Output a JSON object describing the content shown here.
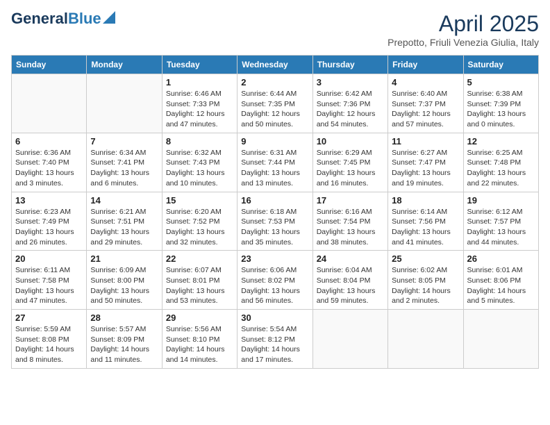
{
  "header": {
    "logo_line1": "General",
    "logo_line2": "Blue",
    "month_year": "April 2025",
    "location": "Prepotto, Friuli Venezia Giulia, Italy"
  },
  "days_of_week": [
    "Sunday",
    "Monday",
    "Tuesday",
    "Wednesday",
    "Thursday",
    "Friday",
    "Saturday"
  ],
  "weeks": [
    [
      {
        "day": "",
        "info": ""
      },
      {
        "day": "",
        "info": ""
      },
      {
        "day": "1",
        "info": "Sunrise: 6:46 AM\nSunset: 7:33 PM\nDaylight: 12 hours and 47 minutes."
      },
      {
        "day": "2",
        "info": "Sunrise: 6:44 AM\nSunset: 7:35 PM\nDaylight: 12 hours and 50 minutes."
      },
      {
        "day": "3",
        "info": "Sunrise: 6:42 AM\nSunset: 7:36 PM\nDaylight: 12 hours and 54 minutes."
      },
      {
        "day": "4",
        "info": "Sunrise: 6:40 AM\nSunset: 7:37 PM\nDaylight: 12 hours and 57 minutes."
      },
      {
        "day": "5",
        "info": "Sunrise: 6:38 AM\nSunset: 7:39 PM\nDaylight: 13 hours and 0 minutes."
      }
    ],
    [
      {
        "day": "6",
        "info": "Sunrise: 6:36 AM\nSunset: 7:40 PM\nDaylight: 13 hours and 3 minutes."
      },
      {
        "day": "7",
        "info": "Sunrise: 6:34 AM\nSunset: 7:41 PM\nDaylight: 13 hours and 6 minutes."
      },
      {
        "day": "8",
        "info": "Sunrise: 6:32 AM\nSunset: 7:43 PM\nDaylight: 13 hours and 10 minutes."
      },
      {
        "day": "9",
        "info": "Sunrise: 6:31 AM\nSunset: 7:44 PM\nDaylight: 13 hours and 13 minutes."
      },
      {
        "day": "10",
        "info": "Sunrise: 6:29 AM\nSunset: 7:45 PM\nDaylight: 13 hours and 16 minutes."
      },
      {
        "day": "11",
        "info": "Sunrise: 6:27 AM\nSunset: 7:47 PM\nDaylight: 13 hours and 19 minutes."
      },
      {
        "day": "12",
        "info": "Sunrise: 6:25 AM\nSunset: 7:48 PM\nDaylight: 13 hours and 22 minutes."
      }
    ],
    [
      {
        "day": "13",
        "info": "Sunrise: 6:23 AM\nSunset: 7:49 PM\nDaylight: 13 hours and 26 minutes."
      },
      {
        "day": "14",
        "info": "Sunrise: 6:21 AM\nSunset: 7:51 PM\nDaylight: 13 hours and 29 minutes."
      },
      {
        "day": "15",
        "info": "Sunrise: 6:20 AM\nSunset: 7:52 PM\nDaylight: 13 hours and 32 minutes."
      },
      {
        "day": "16",
        "info": "Sunrise: 6:18 AM\nSunset: 7:53 PM\nDaylight: 13 hours and 35 minutes."
      },
      {
        "day": "17",
        "info": "Sunrise: 6:16 AM\nSunset: 7:54 PM\nDaylight: 13 hours and 38 minutes."
      },
      {
        "day": "18",
        "info": "Sunrise: 6:14 AM\nSunset: 7:56 PM\nDaylight: 13 hours and 41 minutes."
      },
      {
        "day": "19",
        "info": "Sunrise: 6:12 AM\nSunset: 7:57 PM\nDaylight: 13 hours and 44 minutes."
      }
    ],
    [
      {
        "day": "20",
        "info": "Sunrise: 6:11 AM\nSunset: 7:58 PM\nDaylight: 13 hours and 47 minutes."
      },
      {
        "day": "21",
        "info": "Sunrise: 6:09 AM\nSunset: 8:00 PM\nDaylight: 13 hours and 50 minutes."
      },
      {
        "day": "22",
        "info": "Sunrise: 6:07 AM\nSunset: 8:01 PM\nDaylight: 13 hours and 53 minutes."
      },
      {
        "day": "23",
        "info": "Sunrise: 6:06 AM\nSunset: 8:02 PM\nDaylight: 13 hours and 56 minutes."
      },
      {
        "day": "24",
        "info": "Sunrise: 6:04 AM\nSunset: 8:04 PM\nDaylight: 13 hours and 59 minutes."
      },
      {
        "day": "25",
        "info": "Sunrise: 6:02 AM\nSunset: 8:05 PM\nDaylight: 14 hours and 2 minutes."
      },
      {
        "day": "26",
        "info": "Sunrise: 6:01 AM\nSunset: 8:06 PM\nDaylight: 14 hours and 5 minutes."
      }
    ],
    [
      {
        "day": "27",
        "info": "Sunrise: 5:59 AM\nSunset: 8:08 PM\nDaylight: 14 hours and 8 minutes."
      },
      {
        "day": "28",
        "info": "Sunrise: 5:57 AM\nSunset: 8:09 PM\nDaylight: 14 hours and 11 minutes."
      },
      {
        "day": "29",
        "info": "Sunrise: 5:56 AM\nSunset: 8:10 PM\nDaylight: 14 hours and 14 minutes."
      },
      {
        "day": "30",
        "info": "Sunrise: 5:54 AM\nSunset: 8:12 PM\nDaylight: 14 hours and 17 minutes."
      },
      {
        "day": "",
        "info": ""
      },
      {
        "day": "",
        "info": ""
      },
      {
        "day": "",
        "info": ""
      }
    ]
  ]
}
